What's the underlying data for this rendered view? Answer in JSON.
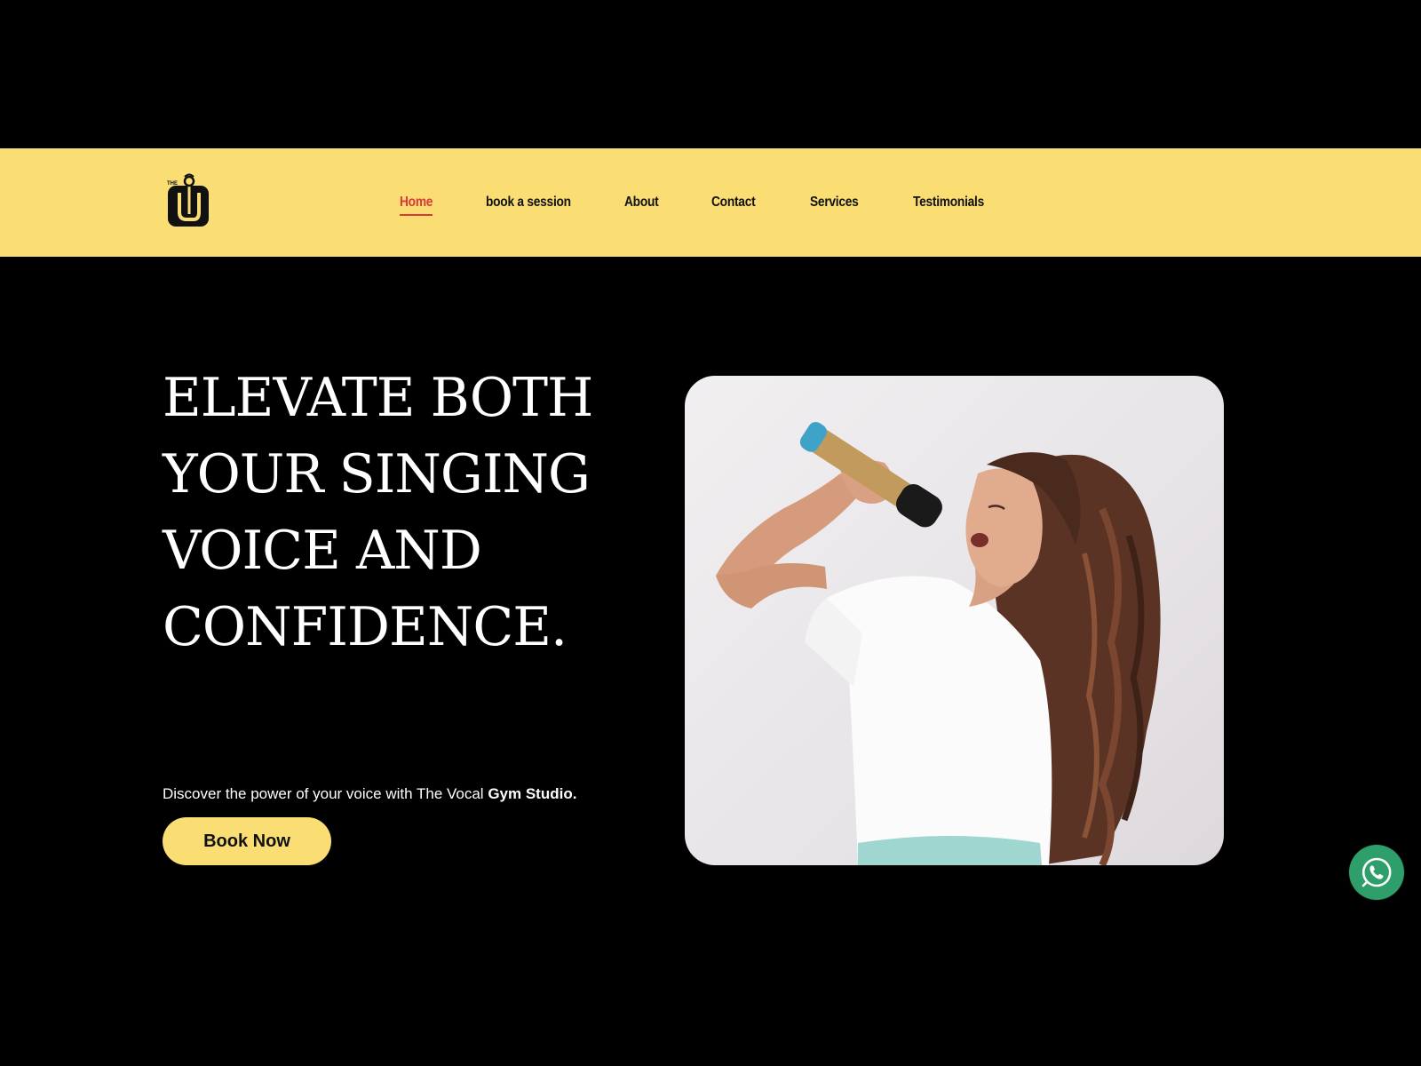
{
  "brand": {
    "logo_text": "THE",
    "accent": "#FADE74",
    "active_color": "#D9393A",
    "background": "#000000"
  },
  "nav": {
    "items": [
      {
        "label": "Home",
        "active": true
      },
      {
        "label": "book a session",
        "active": false
      },
      {
        "label": "About",
        "active": false
      },
      {
        "label": "Contact",
        "active": false
      },
      {
        "label": "Services",
        "active": false
      },
      {
        "label": "Testimonials",
        "active": false
      }
    ]
  },
  "hero": {
    "title_lines": [
      "ELEVATE BOTH",
      "YOUR SINGING",
      "VOICE AND",
      "CONFIDENCE."
    ],
    "subtitle_prefix": "Discover the power of your voice with The Vocal ",
    "subtitle_bold": "Gym Studio.",
    "cta_label": "Book Now",
    "image_icon": "singer-with-microphone-photo"
  },
  "floating": {
    "whatsapp_icon": "whatsapp-icon",
    "whatsapp_color": "#2E9E6B"
  }
}
